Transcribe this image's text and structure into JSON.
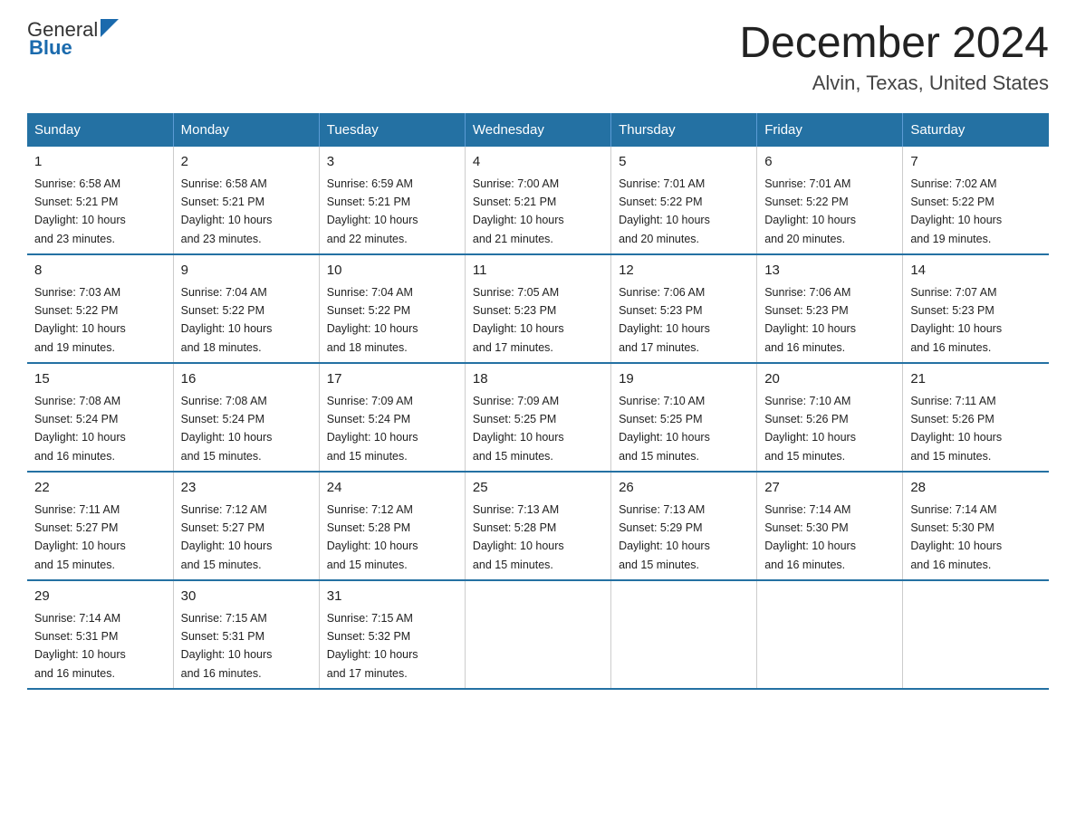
{
  "header": {
    "logo_general": "General",
    "logo_blue": "Blue",
    "month": "December 2024",
    "location": "Alvin, Texas, United States"
  },
  "days_of_week": [
    "Sunday",
    "Monday",
    "Tuesday",
    "Wednesday",
    "Thursday",
    "Friday",
    "Saturday"
  ],
  "weeks": [
    [
      {
        "day": "1",
        "sunrise": "6:58 AM",
        "sunset": "5:21 PM",
        "daylight": "10 hours and 23 minutes."
      },
      {
        "day": "2",
        "sunrise": "6:58 AM",
        "sunset": "5:21 PM",
        "daylight": "10 hours and 23 minutes."
      },
      {
        "day": "3",
        "sunrise": "6:59 AM",
        "sunset": "5:21 PM",
        "daylight": "10 hours and 22 minutes."
      },
      {
        "day": "4",
        "sunrise": "7:00 AM",
        "sunset": "5:21 PM",
        "daylight": "10 hours and 21 minutes."
      },
      {
        "day": "5",
        "sunrise": "7:01 AM",
        "sunset": "5:22 PM",
        "daylight": "10 hours and 20 minutes."
      },
      {
        "day": "6",
        "sunrise": "7:01 AM",
        "sunset": "5:22 PM",
        "daylight": "10 hours and 20 minutes."
      },
      {
        "day": "7",
        "sunrise": "7:02 AM",
        "sunset": "5:22 PM",
        "daylight": "10 hours and 19 minutes."
      }
    ],
    [
      {
        "day": "8",
        "sunrise": "7:03 AM",
        "sunset": "5:22 PM",
        "daylight": "10 hours and 19 minutes."
      },
      {
        "day": "9",
        "sunrise": "7:04 AM",
        "sunset": "5:22 PM",
        "daylight": "10 hours and 18 minutes."
      },
      {
        "day": "10",
        "sunrise": "7:04 AM",
        "sunset": "5:22 PM",
        "daylight": "10 hours and 18 minutes."
      },
      {
        "day": "11",
        "sunrise": "7:05 AM",
        "sunset": "5:23 PM",
        "daylight": "10 hours and 17 minutes."
      },
      {
        "day": "12",
        "sunrise": "7:06 AM",
        "sunset": "5:23 PM",
        "daylight": "10 hours and 17 minutes."
      },
      {
        "day": "13",
        "sunrise": "7:06 AM",
        "sunset": "5:23 PM",
        "daylight": "10 hours and 16 minutes."
      },
      {
        "day": "14",
        "sunrise": "7:07 AM",
        "sunset": "5:23 PM",
        "daylight": "10 hours and 16 minutes."
      }
    ],
    [
      {
        "day": "15",
        "sunrise": "7:08 AM",
        "sunset": "5:24 PM",
        "daylight": "10 hours and 16 minutes."
      },
      {
        "day": "16",
        "sunrise": "7:08 AM",
        "sunset": "5:24 PM",
        "daylight": "10 hours and 15 minutes."
      },
      {
        "day": "17",
        "sunrise": "7:09 AM",
        "sunset": "5:24 PM",
        "daylight": "10 hours and 15 minutes."
      },
      {
        "day": "18",
        "sunrise": "7:09 AM",
        "sunset": "5:25 PM",
        "daylight": "10 hours and 15 minutes."
      },
      {
        "day": "19",
        "sunrise": "7:10 AM",
        "sunset": "5:25 PM",
        "daylight": "10 hours and 15 minutes."
      },
      {
        "day": "20",
        "sunrise": "7:10 AM",
        "sunset": "5:26 PM",
        "daylight": "10 hours and 15 minutes."
      },
      {
        "day": "21",
        "sunrise": "7:11 AM",
        "sunset": "5:26 PM",
        "daylight": "10 hours and 15 minutes."
      }
    ],
    [
      {
        "day": "22",
        "sunrise": "7:11 AM",
        "sunset": "5:27 PM",
        "daylight": "10 hours and 15 minutes."
      },
      {
        "day": "23",
        "sunrise": "7:12 AM",
        "sunset": "5:27 PM",
        "daylight": "10 hours and 15 minutes."
      },
      {
        "day": "24",
        "sunrise": "7:12 AM",
        "sunset": "5:28 PM",
        "daylight": "10 hours and 15 minutes."
      },
      {
        "day": "25",
        "sunrise": "7:13 AM",
        "sunset": "5:28 PM",
        "daylight": "10 hours and 15 minutes."
      },
      {
        "day": "26",
        "sunrise": "7:13 AM",
        "sunset": "5:29 PM",
        "daylight": "10 hours and 15 minutes."
      },
      {
        "day": "27",
        "sunrise": "7:14 AM",
        "sunset": "5:30 PM",
        "daylight": "10 hours and 16 minutes."
      },
      {
        "day": "28",
        "sunrise": "7:14 AM",
        "sunset": "5:30 PM",
        "daylight": "10 hours and 16 minutes."
      }
    ],
    [
      {
        "day": "29",
        "sunrise": "7:14 AM",
        "sunset": "5:31 PM",
        "daylight": "10 hours and 16 minutes."
      },
      {
        "day": "30",
        "sunrise": "7:15 AM",
        "sunset": "5:31 PM",
        "daylight": "10 hours and 16 minutes."
      },
      {
        "day": "31",
        "sunrise": "7:15 AM",
        "sunset": "5:32 PM",
        "daylight": "10 hours and 17 minutes."
      },
      null,
      null,
      null,
      null
    ]
  ],
  "labels": {
    "sunrise": "Sunrise:",
    "sunset": "Sunset:",
    "daylight": "Daylight:"
  }
}
